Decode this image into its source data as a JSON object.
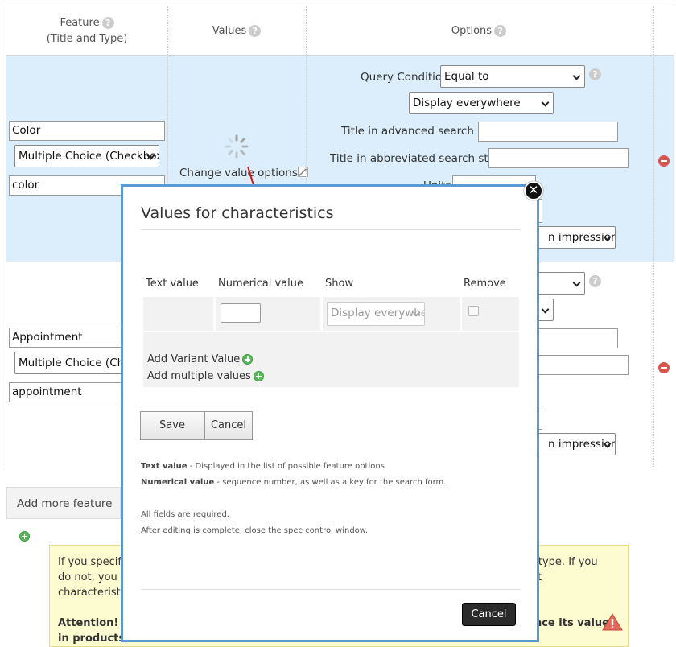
{
  "table": {
    "headers": {
      "feature": "Feature",
      "feature_sub": "(Title and Type)",
      "values": "Values",
      "options": "Options"
    },
    "features": [
      {
        "title": "Color",
        "type": "Multiple Choice (Checkbox)",
        "key": "color",
        "values_link": "Change value options",
        "query_condition_label": "Query Condition:",
        "query_condition": "Equal to",
        "display": "Display everywhere",
        "adv_search_label": "Title in advanced search box:",
        "abbr_search_label": "Title in abbreviated search string:",
        "units_label": "Units",
        "impression": "n impression"
      },
      {
        "title": "Appointment",
        "type": "Multiple Choice (Checkbox)",
        "key": "appointment",
        "impression": "n impression"
      }
    ]
  },
  "add_feature_label": "Add more feature",
  "notice": {
    "line1_start": "If you specify",
    "line1_end": "ic type. If you",
    "line2_start": "do not, you w",
    "line2_end": "t",
    "line3_start": "characteristic",
    "attention_start": "Attention! If",
    "attention_end": "lace its value",
    "attention_line2": "in products."
  },
  "modal": {
    "title": "Values for characteristics",
    "columns": [
      "Text value",
      "Numerical value",
      "Show",
      "Remove"
    ],
    "row": {
      "text_value": "",
      "numerical_value": "",
      "show": "Display everywhere"
    },
    "add_variant": "Add Variant Value",
    "add_multiple": "Add multiple values",
    "save": "Save",
    "cancel": "Cancel",
    "help_text_term": "Text value",
    "help_text_desc": " - Displayed in the list of possible feature options",
    "help_num_term": "Numerical value",
    "help_num_desc": " - sequence number, as well as a key for the search form.",
    "note_required": "All fields are required.",
    "note_close": "After editing is complete, close the spec control window.",
    "footer_cancel": "Cancel"
  },
  "colors": {
    "row_highlight": "#dceefb",
    "modal_border": "#5b9bd5",
    "notice_bg": "#fdfbd0",
    "remove_icon": "#d9534f",
    "add_icon": "#5cb85c"
  }
}
